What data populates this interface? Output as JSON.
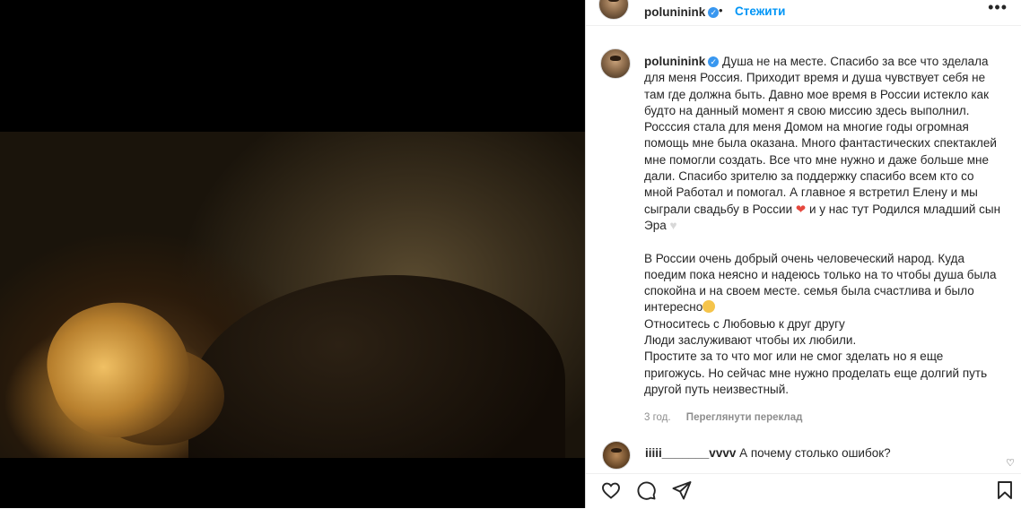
{
  "post": {
    "username": "poluninink",
    "verified_icon": "verified-badge-icon",
    "follow_label": "Стежити",
    "dot": "•",
    "more_label": "•••"
  },
  "caption": {
    "username": "poluninink",
    "para1": "Душа не на месте. Спасибо за все что зделала для меня Россия. Приходит время и душа чувствует себя не там где должна быть. Давно мое время в России истекло как будто на данный момент я свою миссию здесь выполнил. Росссия стала для меня Домом на многие годы огромная помощь мне была оказана. Много фантастических спектаклей мне помогли создать. Все что мне нужно и даже больше мне дали. Спасибо зрителю за поддержку спасибо всем кто со мной Работал и помогал. А главное я встретил Елену и мы сыграли свадьбу в России",
    "para1_mid": "и у нас тут Родился младший сын Эра",
    "para2": "В России очень добрый очень человеческий народ. Куда поедим пока неясно и надеюсь только на то чтобы душа была спокойна и на своем месте. семья была счастлива и было интересно",
    "line3": "Относитесь с Любовью к друг другу",
    "line4": "Люди заслуживают чтобы их любили.",
    "line5": "Простите за то что мог или не смог зделать но я еще пригожусь. Но сейчас мне нужно проделать еще долгий путь другой путь неизвестный."
  },
  "meta": {
    "time": "3 год.",
    "translate_label": "Переглянути переклад"
  },
  "comment": {
    "username": "iiiii_______vvvv",
    "text": "А почему столько ошибок?"
  },
  "icons": {
    "like": "heart-icon",
    "comment": "comment-icon",
    "share": "share-icon",
    "save": "bookmark-icon"
  },
  "colors": {
    "link_blue": "#0095f6",
    "verified_blue": "#3897f0",
    "text": "#262626",
    "muted": "#8e8e8e"
  }
}
